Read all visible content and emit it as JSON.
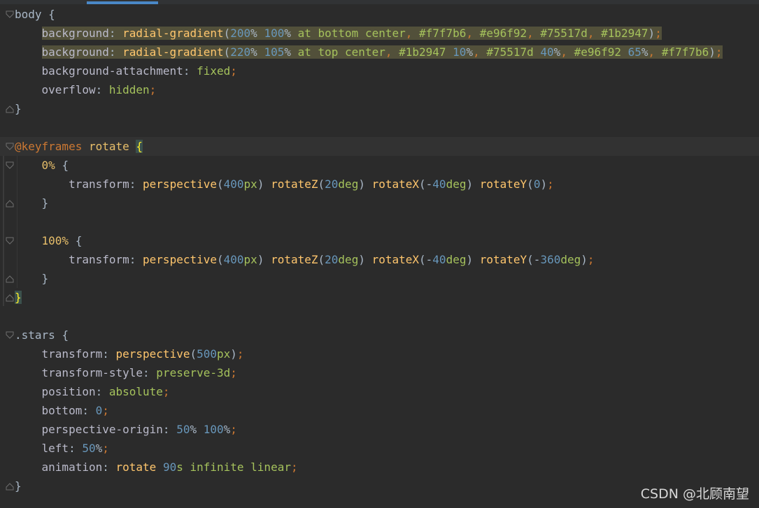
{
  "editor": {
    "watermark": "CSDN @北顾南望",
    "lines": [
      {
        "id": "l1",
        "tokens": [
          [
            "sel-plain",
            "body "
          ],
          [
            "sel-plain",
            "{"
          ]
        ]
      },
      {
        "id": "l2",
        "tokens": [
          [
            "prop",
            "    background"
          ],
          [
            "sel-plain",
            ": "
          ],
          [
            "func",
            "radial-gradient"
          ],
          [
            "sel-plain",
            "("
          ],
          [
            "num",
            "200"
          ],
          [
            "sel-plain",
            "% "
          ],
          [
            "num",
            "100"
          ],
          [
            "sel-plain",
            "% "
          ],
          [
            "val",
            "at bottom center"
          ],
          [
            "punc",
            ", "
          ],
          [
            "val",
            "#f7f7b6"
          ],
          [
            "punc",
            ", "
          ],
          [
            "val",
            "#e96f92"
          ],
          [
            "punc",
            ", "
          ],
          [
            "val",
            "#75517d"
          ],
          [
            "punc",
            ", "
          ],
          [
            "val",
            "#1b2947"
          ],
          [
            "sel-plain",
            ")"
          ],
          [
            "punc",
            ";"
          ]
        ],
        "highlight": true
      },
      {
        "id": "l3",
        "tokens": [
          [
            "prop",
            "    background"
          ],
          [
            "sel-plain",
            ": "
          ],
          [
            "func",
            "radial-gradient"
          ],
          [
            "sel-plain",
            "("
          ],
          [
            "num",
            "220"
          ],
          [
            "sel-plain",
            "% "
          ],
          [
            "num",
            "105"
          ],
          [
            "sel-plain",
            "% "
          ],
          [
            "val",
            "at top center"
          ],
          [
            "punc",
            ", "
          ],
          [
            "val",
            "#1b2947 "
          ],
          [
            "num",
            "10"
          ],
          [
            "sel-plain",
            "%"
          ],
          [
            "punc",
            ", "
          ],
          [
            "val",
            "#75517d "
          ],
          [
            "num",
            "40"
          ],
          [
            "sel-plain",
            "%"
          ],
          [
            "punc",
            ", "
          ],
          [
            "val",
            "#e96f92 "
          ],
          [
            "num",
            "65"
          ],
          [
            "sel-plain",
            "%"
          ],
          [
            "punc",
            ", "
          ],
          [
            "val",
            "#f7f7b6"
          ],
          [
            "sel-plain",
            ")"
          ],
          [
            "punc",
            ";"
          ]
        ],
        "highlight": true
      },
      {
        "id": "l4",
        "tokens": [
          [
            "prop",
            "    background-attachment"
          ],
          [
            "sel-plain",
            ": "
          ],
          [
            "val",
            "fixed"
          ],
          [
            "punc",
            ";"
          ]
        ]
      },
      {
        "id": "l5",
        "tokens": [
          [
            "prop",
            "    overflow"
          ],
          [
            "sel-plain",
            ": "
          ],
          [
            "val",
            "hidden"
          ],
          [
            "punc",
            ";"
          ]
        ]
      },
      {
        "id": "l6",
        "tokens": [
          [
            "sel-plain",
            "}"
          ]
        ]
      },
      {
        "id": "l7",
        "tokens": []
      },
      {
        "id": "l8",
        "tokens": [
          [
            "at",
            "@keyframes "
          ],
          [
            "name",
            "rotate "
          ],
          [
            "brace-hl",
            "{"
          ]
        ],
        "current": true
      },
      {
        "id": "l9",
        "tokens": [
          [
            "sel",
            "    0% "
          ],
          [
            "sel-plain",
            "{"
          ]
        ]
      },
      {
        "id": "l10",
        "tokens": [
          [
            "prop",
            "        transform"
          ],
          [
            "sel-plain",
            ": "
          ],
          [
            "func",
            "perspective"
          ],
          [
            "sel-plain",
            "("
          ],
          [
            "num",
            "400"
          ],
          [
            "val",
            "px"
          ],
          [
            "sel-plain",
            ") "
          ],
          [
            "func",
            "rotateZ"
          ],
          [
            "sel-plain",
            "("
          ],
          [
            "num",
            "20"
          ],
          [
            "val",
            "deg"
          ],
          [
            "sel-plain",
            ") "
          ],
          [
            "func",
            "rotateX"
          ],
          [
            "sel-plain",
            "(-"
          ],
          [
            "num",
            "40"
          ],
          [
            "val",
            "deg"
          ],
          [
            "sel-plain",
            ") "
          ],
          [
            "func",
            "rotateY"
          ],
          [
            "sel-plain",
            "("
          ],
          [
            "num",
            "0"
          ],
          [
            "sel-plain",
            ")"
          ],
          [
            "punc",
            ";"
          ]
        ]
      },
      {
        "id": "l11",
        "tokens": [
          [
            "sel-plain",
            "    }"
          ]
        ]
      },
      {
        "id": "l12",
        "tokens": []
      },
      {
        "id": "l13",
        "tokens": [
          [
            "sel",
            "    100% "
          ],
          [
            "sel-plain",
            "{"
          ]
        ]
      },
      {
        "id": "l14",
        "tokens": [
          [
            "prop",
            "        transform"
          ],
          [
            "sel-plain",
            ": "
          ],
          [
            "func",
            "perspective"
          ],
          [
            "sel-plain",
            "("
          ],
          [
            "num",
            "400"
          ],
          [
            "val",
            "px"
          ],
          [
            "sel-plain",
            ") "
          ],
          [
            "func",
            "rotateZ"
          ],
          [
            "sel-plain",
            "("
          ],
          [
            "num",
            "20"
          ],
          [
            "val",
            "deg"
          ],
          [
            "sel-plain",
            ") "
          ],
          [
            "func",
            "rotateX"
          ],
          [
            "sel-plain",
            "(-"
          ],
          [
            "num",
            "40"
          ],
          [
            "val",
            "deg"
          ],
          [
            "sel-plain",
            ") "
          ],
          [
            "func",
            "rotateY"
          ],
          [
            "sel-plain",
            "(-"
          ],
          [
            "num",
            "360"
          ],
          [
            "val",
            "deg"
          ],
          [
            "sel-plain",
            ")"
          ],
          [
            "punc",
            ";"
          ]
        ]
      },
      {
        "id": "l15",
        "tokens": [
          [
            "sel-plain",
            "    }"
          ]
        ]
      },
      {
        "id": "l16",
        "tokens": [
          [
            "brace-hl",
            "}"
          ]
        ]
      },
      {
        "id": "l17",
        "tokens": []
      },
      {
        "id": "l18",
        "tokens": [
          [
            "sel-plain",
            ".stars "
          ],
          [
            "sel-plain",
            "{"
          ]
        ]
      },
      {
        "id": "l19",
        "tokens": [
          [
            "prop",
            "    transform"
          ],
          [
            "sel-plain",
            ": "
          ],
          [
            "func",
            "perspective"
          ],
          [
            "sel-plain",
            "("
          ],
          [
            "num",
            "500"
          ],
          [
            "val",
            "px"
          ],
          [
            "sel-plain",
            ")"
          ],
          [
            "punc",
            ";"
          ]
        ]
      },
      {
        "id": "l20",
        "tokens": [
          [
            "prop",
            "    transform-style"
          ],
          [
            "sel-plain",
            ": "
          ],
          [
            "val",
            "preserve-3d"
          ],
          [
            "punc",
            ";"
          ]
        ]
      },
      {
        "id": "l21",
        "tokens": [
          [
            "prop",
            "    position"
          ],
          [
            "sel-plain",
            ": "
          ],
          [
            "val",
            "absolute"
          ],
          [
            "punc",
            ";"
          ]
        ]
      },
      {
        "id": "l22",
        "tokens": [
          [
            "prop",
            "    bottom"
          ],
          [
            "sel-plain",
            ": "
          ],
          [
            "num",
            "0"
          ],
          [
            "punc",
            ";"
          ]
        ]
      },
      {
        "id": "l23",
        "tokens": [
          [
            "prop",
            "    perspective-origin"
          ],
          [
            "sel-plain",
            ": "
          ],
          [
            "num",
            "50"
          ],
          [
            "sel-plain",
            "% "
          ],
          [
            "num",
            "100"
          ],
          [
            "sel-plain",
            "%"
          ],
          [
            "punc",
            ";"
          ]
        ]
      },
      {
        "id": "l24",
        "tokens": [
          [
            "prop",
            "    left"
          ],
          [
            "sel-plain",
            ": "
          ],
          [
            "num",
            "50"
          ],
          [
            "sel-plain",
            "%"
          ],
          [
            "punc",
            ";"
          ]
        ]
      },
      {
        "id": "l25",
        "tokens": [
          [
            "prop",
            "    animation"
          ],
          [
            "sel-plain",
            ": "
          ],
          [
            "func",
            "rotate "
          ],
          [
            "num",
            "90"
          ],
          [
            "val",
            "s infinite linear"
          ],
          [
            "punc",
            ";"
          ]
        ]
      },
      {
        "id": "l26",
        "tokens": [
          [
            "sel-plain",
            "}"
          ]
        ]
      }
    ]
  }
}
